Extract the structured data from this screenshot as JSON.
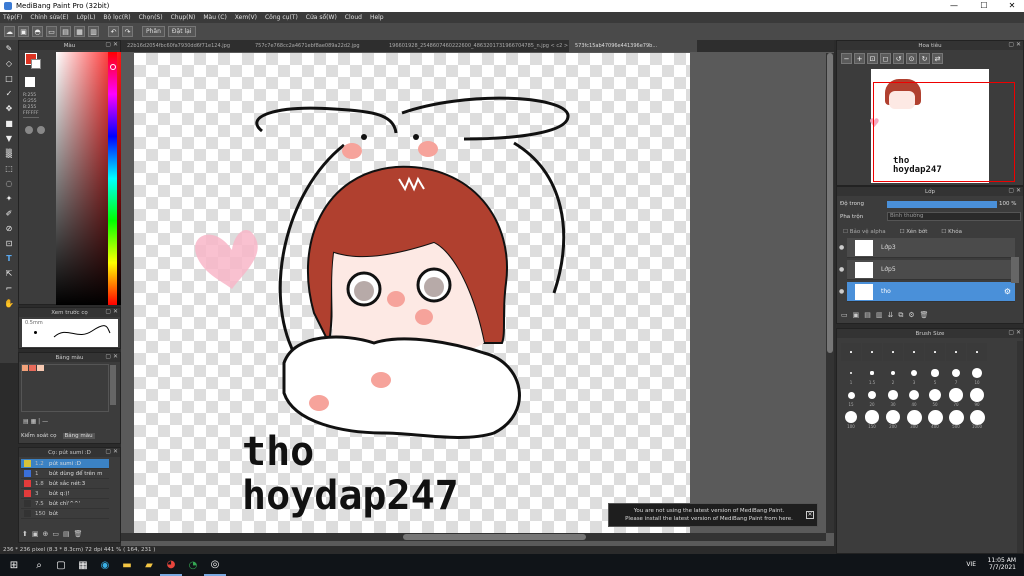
{
  "window": {
    "title": "MediBang Paint Pro (32bit)",
    "controls": [
      "—",
      "☐",
      "✕"
    ]
  },
  "menu": [
    "Tệp(F)",
    "Chỉnh sửa(E)",
    "Lớp(L)",
    "Bộ lọc(R)",
    "Chọn(S)",
    "Chụp(N)",
    "Màu (C)",
    "Xem(V)",
    "Công cụ(T)",
    "Cửa sổ(W)",
    "Cloud",
    "Help"
  ],
  "toolbar": {
    "mode_label": "Phân",
    "cancel_label": "Đặt lại"
  },
  "color_panel": {
    "title": "Màu",
    "r": "R:255",
    "g": "G:255",
    "b": "B:255",
    "hex": "FFFFFF"
  },
  "brush_preview": {
    "title": "Xem trước cọ",
    "size": "0.5mm"
  },
  "palette": {
    "title": "Bảng màu",
    "tabs": [
      "Kiểm soát cọ",
      "Bảng màu"
    ],
    "swatches": [
      "#f2a27a",
      "#e86a5a",
      "#f7c9b2"
    ]
  },
  "brushes": {
    "title": "Cọ: pút sumi :D",
    "items": [
      {
        "size": "1.2",
        "name": "pút sumi :D",
        "color": "#d7c238",
        "selected": true
      },
      {
        "size": "1",
        "name": "bút dùng để trên m",
        "color": "#3a6fd8",
        "selected": false
      },
      {
        "size": "1.8",
        "name": "bút sắc nét:3",
        "color": "#e23b3b",
        "selected": false
      },
      {
        "size": "3",
        "name": "bút q:)!",
        "color": "#e23b3b",
        "selected": false
      },
      {
        "size": "7.5",
        "name": "bút chì'^^'",
        "color": "#333333",
        "selected": false
      },
      {
        "size": "150",
        "name": "bút",
        "color": "#333333",
        "selected": false
      }
    ]
  },
  "tabs": [
    {
      "label": "22b16d2054fbc60fa7930dd6f71e124.jpg",
      "active": false
    },
    {
      "label": "757c7e768cc2a4671ebf8ae089a22d2.jpg",
      "active": false
    },
    {
      "label": "196601928_2548607460222600_4863201731966704785_n.jpg < c2 >",
      "active": false
    },
    {
      "label": "573fc15ab47096e441396e79b...",
      "active": true
    }
  ],
  "canvas_text": {
    "line1": "tho",
    "line2": "hoydap247"
  },
  "notice": {
    "line1": "You are not using the latest version of MediBang Paint.",
    "line2": "Please install the latest version of MediBang Paint from here."
  },
  "status": "236 * 236 pixel (8.3 * 8.3cm) 72 dpi 441 % ( 164, 231 )",
  "navigator": {
    "title": "Hoa tiêu",
    "thumb_text1": "tho",
    "thumb_text2": "hoydap247"
  },
  "layers": {
    "title": "Lớp",
    "opacity_label": "Độ trong",
    "opacity_value": "100 %",
    "opacity_level": 1.0,
    "blend_label": "Pha trộn",
    "blend_value": "Bình thường",
    "protect_alpha": "Bảo vệ alpha",
    "clipping": "Xén bớt",
    "lock": "Khóa",
    "items": [
      {
        "name": "Lớp3",
        "selected": false
      },
      {
        "name": "Lớp5",
        "selected": false
      },
      {
        "name": "tho",
        "selected": true
      }
    ]
  },
  "brush_size": {
    "title": "Brush Size",
    "labels_row1": [
      "1",
      "1.5",
      "2",
      "3",
      "5",
      "7",
      "10"
    ],
    "labels_row2": [
      "15",
      "20",
      "30",
      "40",
      "50",
      "70",
      "90"
    ],
    "labels_row3": [
      "100",
      "150",
      "200",
      "300",
      "400",
      "500",
      "1000"
    ]
  },
  "clock": {
    "time": "11:05 AM",
    "date": "7/7/2021",
    "lang": "VIE"
  },
  "colors": {
    "accent": "#3b82c4",
    "hair": "#b0402f",
    "blush": "#f6a39b"
  }
}
